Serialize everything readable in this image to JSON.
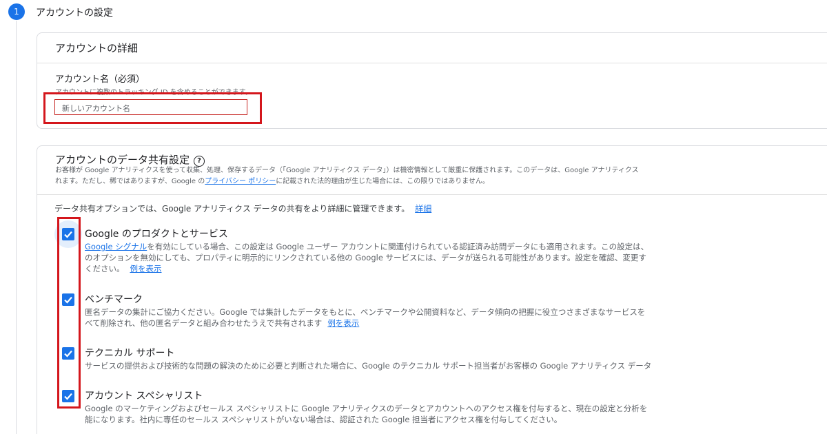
{
  "step": {
    "number": "1",
    "title": "アカウントの設定"
  },
  "account_details": {
    "title": "アカウントの詳細",
    "name_label": "アカウント名（必須）",
    "name_help": "アカウントに複数のトラッキング ID を含めることができます。",
    "name_placeholder": "新しいアカウント名"
  },
  "data_sharing": {
    "title": "アカウントのデータ共有設定",
    "help_icon": "help-circle-icon",
    "desc_line1": "お客様が Google アナリティクスを使って収集、処理、保存するデータ（「Google アナリティクス データ」）は機密情報として厳重に保護されます。このデータは、Google アナリティクス",
    "desc_line2_before": "れます。ただし、稀ではありますが、Google の",
    "privacy_link": "プライバシー ポリシー",
    "desc_line2_after": "に記載された法的理由が生じた場合には、この限りではありません。",
    "intro": "データ共有オプションでは、Google アナリティクス データの共有をより詳細に管理できます。",
    "intro_link": "詳細"
  },
  "options": [
    {
      "title": "Google のプロダクトとサービス",
      "checked": true,
      "link_prefix": "Google シグナル",
      "line1": "を有効にしている場合、この設定は Google ユーザー アカウントに関連付けられている認証済み訪問データにも適用されます。この設定は、",
      "line2": "のオプションを無効にしても、プロパティに明示的にリンクされている他の Google サービスには、データが送られる可能性があります。設定を確認、変更す",
      "line3": "ください。",
      "example_link": "例を表示"
    },
    {
      "title": "ベンチマーク",
      "checked": true,
      "line1": "匿名データの集計にご協力ください。Google では集計したデータをもとに、ベンチマークや公開資料など、データ傾向の把握に役立つさまざまなサービスを",
      "line2": "べて削除され、他の匿名データと組み合わせたうえで共有されます",
      "example_link": "例を表示"
    },
    {
      "title": "テクニカル サポート",
      "checked": true,
      "line1": "サービスの提供および技術的な問題の解決のために必要と判断された場合に、Google のテクニカル サポート担当者がお客様の Google アナリティクス データ"
    },
    {
      "title": "アカウント スペシャリスト",
      "checked": true,
      "line1": "Google のマーケティングおよびセールス スペシャリストに Google アナリティクスのデータとアカウントへのアクセス権を付与すると、現在の設定と分析を",
      "line2": "能になります。社内に専任のセールス スペシャリストがいない場合は、認証された Google 担当者にアクセス権を付与してください。"
    }
  ],
  "colors": {
    "accent": "#1a73e8",
    "highlight": "#d4161c"
  }
}
